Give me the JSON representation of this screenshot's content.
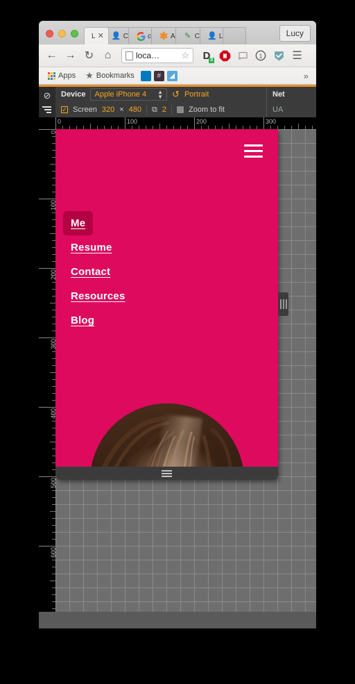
{
  "window": {
    "traffic_lights": [
      "close",
      "minimize",
      "maximize"
    ],
    "profile_name": "Lucy"
  },
  "tabs": [
    {
      "title": "L",
      "favicon": "page-icon",
      "active": true,
      "closable": true
    },
    {
      "title": "C",
      "favicon": "person-icon",
      "active": false
    },
    {
      "title": "c",
      "favicon": "google-icon",
      "active": false
    },
    {
      "title": "A",
      "favicon": "asterisk-icon",
      "active": false
    },
    {
      "title": "C",
      "favicon": "pencil-icon",
      "active": false
    },
    {
      "title": "L",
      "favicon": "person-icon",
      "active": false
    },
    {
      "title": "",
      "favicon": "",
      "active": false
    }
  ],
  "toolbar": {
    "back": "←",
    "forward": "→",
    "reload": "↻",
    "home": "⌂",
    "url": "loca…",
    "bookmark_star": "☆",
    "extensions": [
      {
        "name": "disconnect-extension",
        "glyph": "D",
        "badge": "3"
      },
      {
        "name": "adblock-extension",
        "glyph": "✋",
        "badge": ""
      },
      {
        "name": "cast-icon",
        "glyph": "▭",
        "badge": ""
      },
      {
        "name": "onepassword-extension",
        "glyph": "ⓘ",
        "badge": ""
      },
      {
        "name": "checkmark-extension",
        "glyph": "✔",
        "badge": ""
      }
    ],
    "menu": "☰"
  },
  "bookmarks_bar": {
    "apps_label": "Apps",
    "bookmarks_label": "Bookmarks",
    "shortcuts": [
      {
        "name": "trello-bookmark",
        "glyph": "▐▌",
        "color": "#0079bf"
      },
      {
        "name": "slack-bookmark",
        "glyph": "#",
        "color": "#3e313c"
      },
      {
        "name": "sketch-bookmark",
        "glyph": "◩",
        "color": "#4a9fd5"
      }
    ],
    "overflow": "»"
  },
  "devtools": {
    "left_icons": [
      {
        "name": "disable-javascript-icon",
        "glyph": "⊘"
      },
      {
        "name": "network-throttle-icon",
        "glyph": "≡"
      }
    ],
    "device_label": "Device",
    "device_name": "Apple iPhone 4",
    "orientation_icon": "↺",
    "orientation": "Portrait",
    "screen_checked": true,
    "screen_label": "Screen",
    "screen_width": "320",
    "screen_times": "×",
    "screen_height": "480",
    "dpr_icon": "⧉",
    "dpr": "2",
    "zoom_to_fit_checked": false,
    "zoom_to_fit_label": "Zoom to fit",
    "panel_title": "Net",
    "panel_subtitle": "UA"
  },
  "rulers": {
    "horizontal": [
      "0",
      "100",
      "200",
      "300"
    ],
    "vertical": [
      "0",
      "100",
      "200",
      "300",
      "400",
      "500",
      "600"
    ],
    "major_step": 100,
    "minor_step": 10
  },
  "page": {
    "background_color": "#dd0a5e",
    "active_color": "#b30143",
    "menu_icon": "hamburger-icon",
    "nav_items": [
      {
        "label": "Me",
        "current": true
      },
      {
        "label": "Resume",
        "current": false
      },
      {
        "label": "Contact",
        "current": false
      },
      {
        "label": "Resources",
        "current": false
      },
      {
        "label": "Blog",
        "current": false
      }
    ],
    "avatar_alt": "profile-photo"
  },
  "handles": {
    "bottom": "resize-handle-bottom",
    "right": "resize-handle-right"
  }
}
